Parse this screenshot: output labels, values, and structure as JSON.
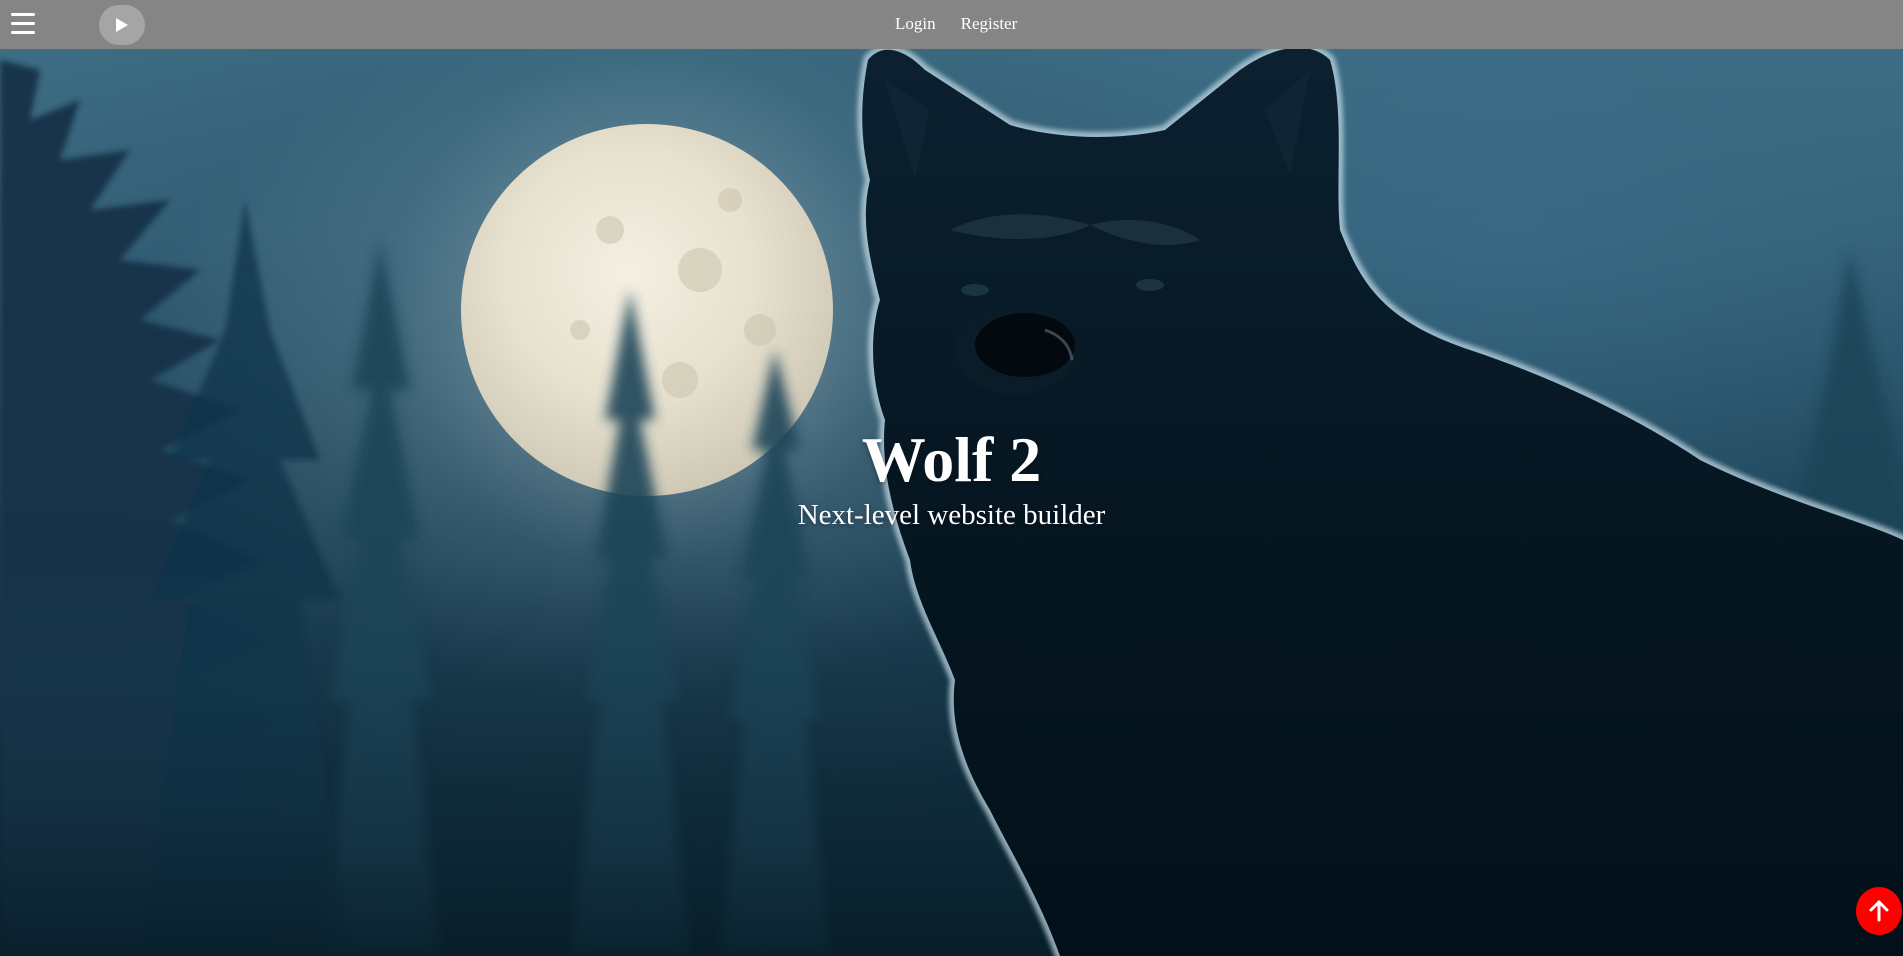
{
  "topbar": {
    "menu_icon": "hamburger-menu-icon",
    "play_icon": "play-icon",
    "nav": {
      "login": "Login",
      "register": "Register"
    }
  },
  "hero": {
    "title": "Wolf 2",
    "subtitle": "Next-level website builder",
    "background_description_icon": "wolf-moon-forest-image"
  },
  "scroll_top": {
    "icon": "arrow-up-icon",
    "color": "#ff0000"
  },
  "colors": {
    "topbar": "#858585",
    "play_button": "#a5a5a5",
    "text": "#ffffff"
  }
}
